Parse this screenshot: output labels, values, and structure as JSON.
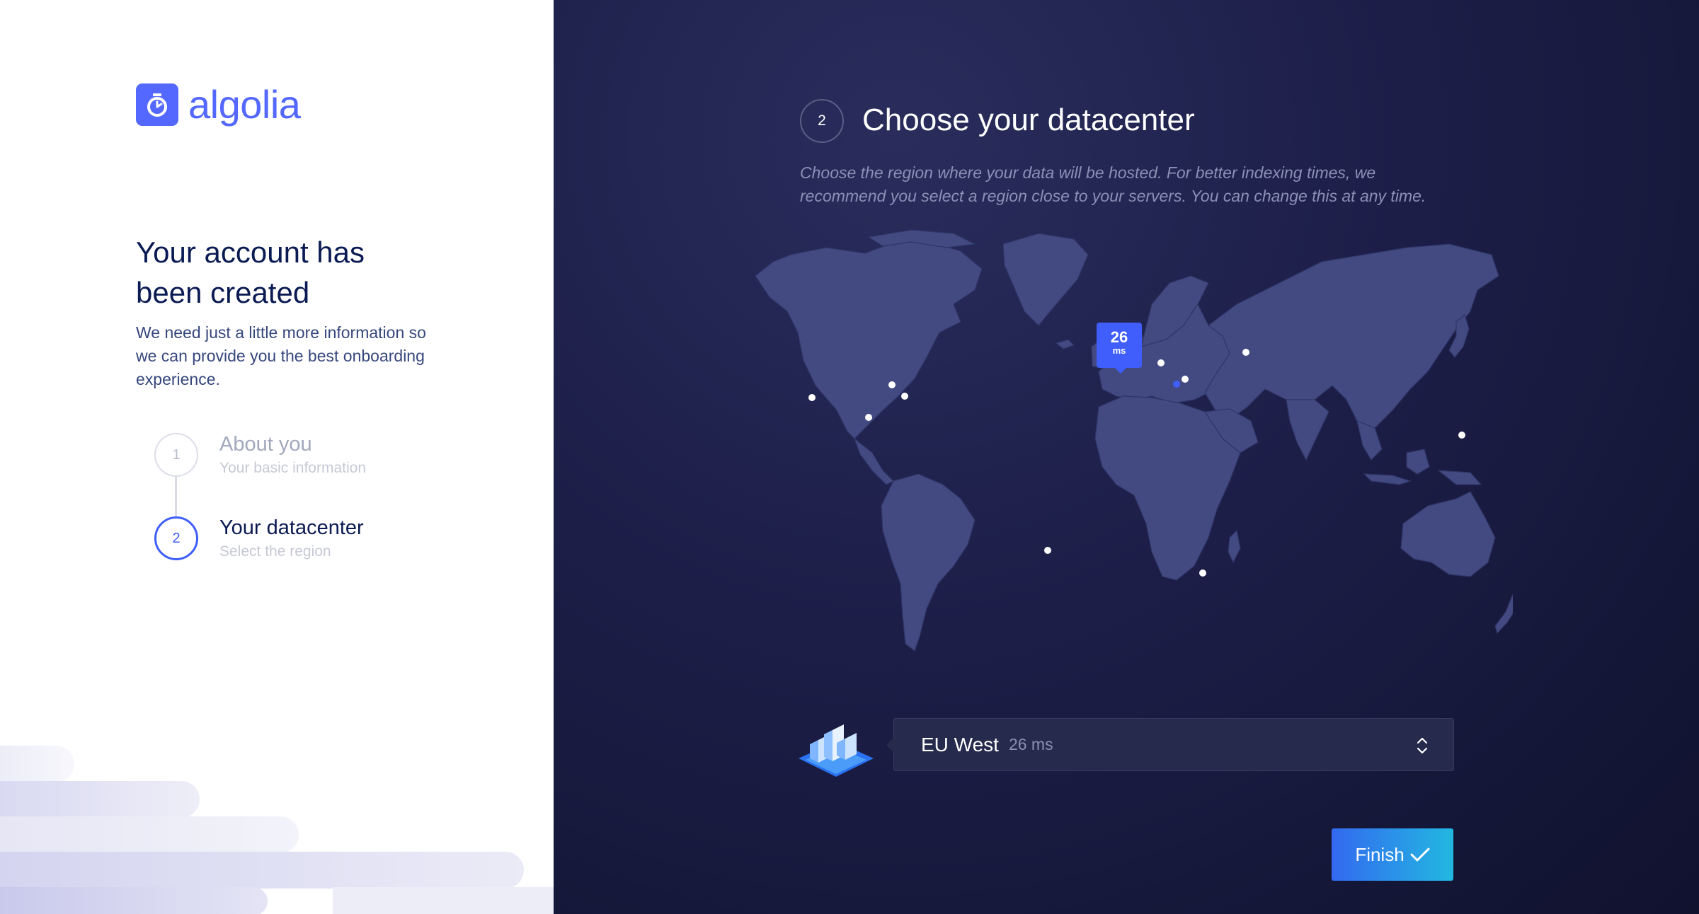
{
  "brand": {
    "name": "algolia",
    "color": "#5468ff"
  },
  "left": {
    "title": "Your account has been created",
    "subtitle": "We need just a little more information so we can provide you the best onboarding experience.",
    "steps": [
      {
        "number": "1",
        "title": "About you",
        "subtitle": "Your basic information",
        "state": "completed"
      },
      {
        "number": "2",
        "title": "Your datacenter",
        "subtitle": "Select the region",
        "state": "active"
      }
    ]
  },
  "right": {
    "step_number": "2",
    "title": "Choose your datacenter",
    "description": "Choose the region where your data will be hosted. For better indexing times, we recommend you select a region close to your servers. You can change this at any time.",
    "map": {
      "tooltip_value": "26",
      "tooltip_unit": "ms",
      "selected_region": "EU West"
    },
    "select": {
      "name": "EU West",
      "latency": "26 ms"
    },
    "finish_label": "Finish",
    "accent": "#3f5efb"
  }
}
